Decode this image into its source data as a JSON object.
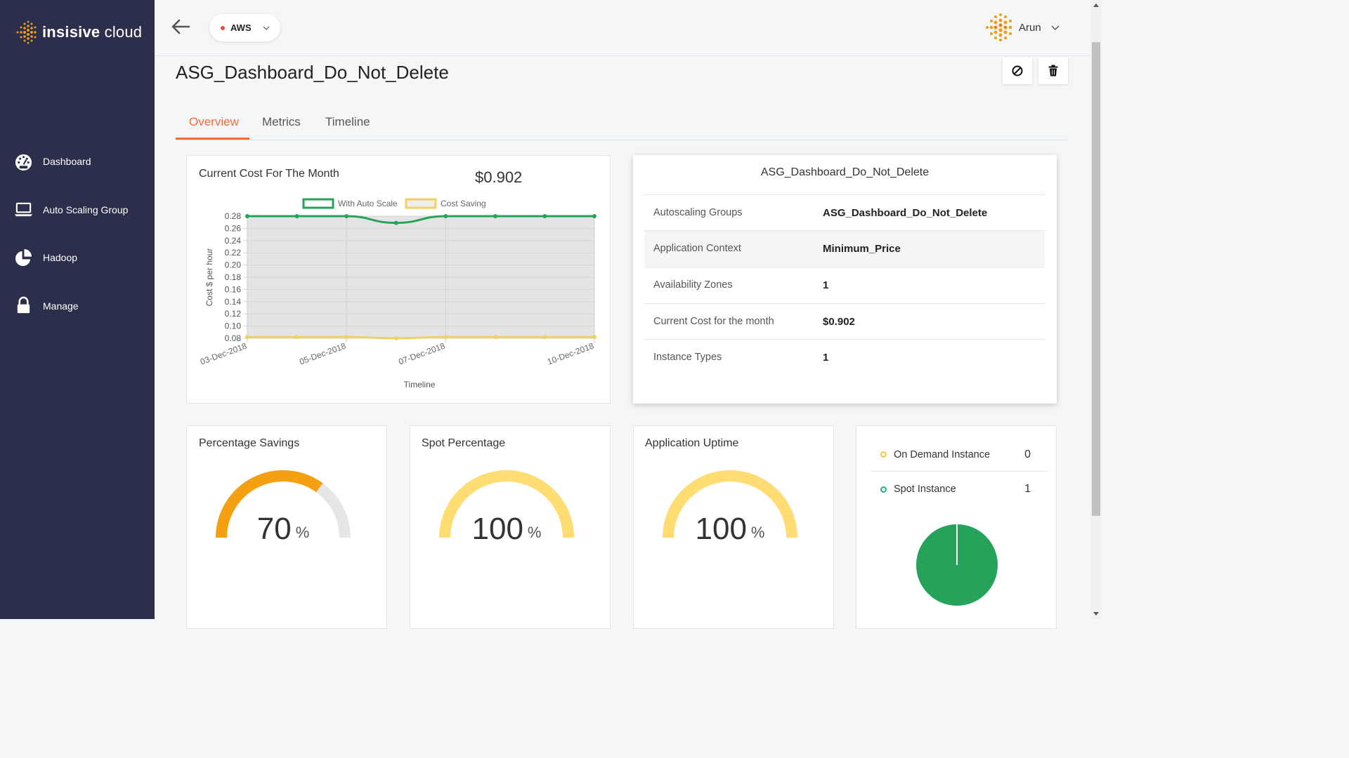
{
  "brand": {
    "name_bold": "insisive",
    "name_light": " cloud",
    "accent": "#f39c12",
    "sidebar_bg": "#2b2f4b"
  },
  "sidebar": {
    "items": [
      {
        "label": "Dashboard",
        "icon": "speedometer-icon"
      },
      {
        "label": "Auto Scaling Group",
        "icon": "laptop-icon"
      },
      {
        "label": "Hadoop",
        "icon": "pie-chart-icon"
      },
      {
        "label": "Manage",
        "icon": "lock-icon"
      }
    ]
  },
  "topbar": {
    "cloud_provider": "AWS",
    "user_name": "Arun"
  },
  "page": {
    "title": "ASG_Dashboard_Do_Not_Delete",
    "tabs": [
      {
        "label": "Overview",
        "active": true
      },
      {
        "label": "Metrics",
        "active": false
      },
      {
        "label": "Timeline",
        "active": false
      }
    ]
  },
  "cost_card": {
    "title": "Current Cost For The Month",
    "value": "$0.902"
  },
  "chart_data": {
    "type": "line",
    "title": "",
    "xlabel": "Timeline",
    "ylabel": "Cost $ per hour",
    "ylim": [
      0.08,
      0.28
    ],
    "yticks": [
      "0.28",
      "0.26",
      "0.24",
      "0.22",
      "0.20",
      "0.18",
      "0.16",
      "0.14",
      "0.12",
      "0.10",
      "0.08"
    ],
    "x": [
      "03-Dec-2018",
      "04-Dec-2018",
      "05-Dec-2018",
      "06-Dec-2018",
      "07-Dec-2018",
      "08-Dec-2018",
      "09-Dec-2018",
      "10-Dec-2018"
    ],
    "xtick_labels": [
      "03-Dec-2018",
      "05-Dec-2018",
      "07-Dec-2018",
      "10-Dec-2018"
    ],
    "legend_position": "top",
    "series": [
      {
        "name": "With Auto Scale",
        "color": "#27a25b",
        "values": [
          0.28,
          0.28,
          0.28,
          0.269,
          0.28,
          0.28,
          0.28,
          0.28
        ]
      },
      {
        "name": "Cost Saving",
        "color": "#f0d060",
        "values": [
          0.082,
          0.082,
          0.082,
          0.08,
          0.082,
          0.082,
          0.082,
          0.082
        ]
      }
    ]
  },
  "details_card": {
    "title": "ASG_Dashboard_Do_Not_Delete",
    "rows": [
      {
        "key": "Autoscaling Groups",
        "value": "ASG_Dashboard_Do_Not_Delete"
      },
      {
        "key": "Application Context",
        "value": "Minimum_Price"
      },
      {
        "key": "Availability Zones",
        "value": "1"
      },
      {
        "key": "Current Cost for the month",
        "value": "$0.902"
      },
      {
        "key": "Instance Types",
        "value": "1"
      }
    ]
  },
  "gauges": [
    {
      "title": "Percentage Savings",
      "value": "70",
      "unit": "%",
      "fraction": 0.7,
      "color": "#f5a011",
      "track": "#e6e6e6"
    },
    {
      "title": "Spot Percentage",
      "value": "100",
      "unit": "%",
      "fraction": 1.0,
      "color": "#ffdd72",
      "track": "#e6e6e6"
    },
    {
      "title": "Application Uptime",
      "value": "100",
      "unit": "%",
      "fraction": 1.0,
      "color": "#ffdd72",
      "track": "#e6e6e6"
    }
  ],
  "instances_card": {
    "legend": [
      {
        "label": "On Demand Instance",
        "count": "0",
        "color": "#f5c842"
      },
      {
        "label": "Spot Instance",
        "count": "1",
        "color": "#20b27a"
      }
    ],
    "pie_color": "#25a35a"
  }
}
